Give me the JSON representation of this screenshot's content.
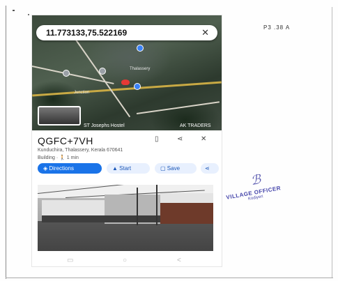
{
  "page_mark": "P3 .38 A",
  "map": {
    "search_value": "11.773133,75.522169",
    "labels": {
      "tl": "Thalassery",
      "mid": "Junction",
      "bottom_left": "ST Josephs Hostel",
      "bottom_right": "AK TRADERS"
    }
  },
  "place": {
    "title": "QGFC+7VH",
    "address": "Kunduchira, Thalassery, Kerala 670641",
    "meta": "Building · 🚶 1 min",
    "actions": {
      "directions": "Directions",
      "start": "Start",
      "save": "Save"
    }
  },
  "stamp": {
    "line1": "VILLAGE OFFICER",
    "line2": "Kodiyeri"
  },
  "icons": {
    "close": "close-icon",
    "bookmark": "bookmark-icon",
    "share": "share-icon"
  }
}
